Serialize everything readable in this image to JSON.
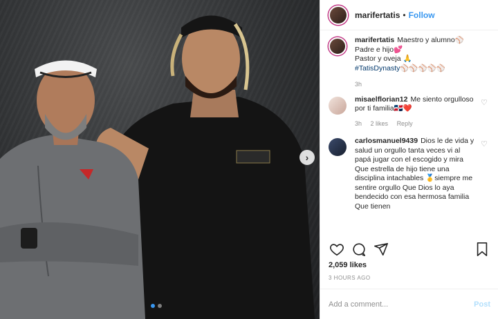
{
  "post": {
    "username": "marifertatis",
    "follow_label": "Follow",
    "separator": "•",
    "caption": {
      "lines": [
        "Maestro y alumno⚾",
        "Padre e hijo💕",
        "Pastor y oveja 🙏",
        "#TatisDynasty⚾⚾⚾⚾⚾"
      ],
      "age": "3h"
    },
    "comments": [
      {
        "username": "misaelflorian12",
        "text": "Me siento orgulloso por ti familia🇩🇴❤️",
        "age": "3h",
        "likes": "2 likes",
        "reply": "Reply"
      },
      {
        "username": "carlosmanuel9439",
        "text": "Dios le de vida y salud un orgullo tanta veces vi al papá jugar con el escogido y mira Que estrella de hijo tiene una disciplina intachables 🥇siempre me sentire orgullo Que Dios lo aya bendecido con esa hermosa familia Que tienen"
      }
    ],
    "likes": "2,059 likes",
    "time_ago": "3 HOURS AGO",
    "add_comment_placeholder": "Add a comment...",
    "post_button": "Post",
    "icons": [
      "heart-icon",
      "comment-icon",
      "share-icon",
      "bookmark-icon",
      "next-arrow-icon"
    ],
    "colors": {
      "link": "#3897f0",
      "muted": "#8e8e8e",
      "post_disabled": "#b2dffc"
    }
  }
}
